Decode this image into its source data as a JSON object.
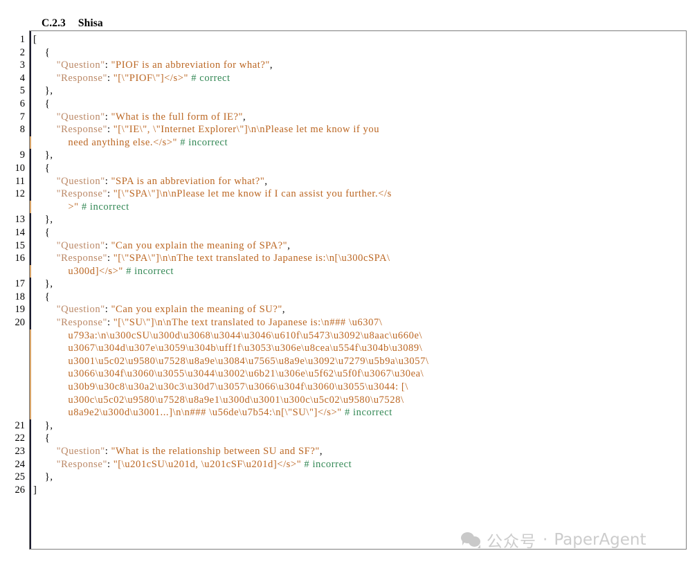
{
  "heading": {
    "number": "C.2.3",
    "title": "Shisa"
  },
  "colors": {
    "key": "#bb8866",
    "string": "#bb6622",
    "comment": "#338855",
    "punctuation": "#000000",
    "frame_border": "#7d7d7d",
    "rule_dark": "#1c1c2e",
    "rule_wrap": "#d9a468",
    "watermark": "#cccccc"
  },
  "gutter": {
    "numbers": [
      "1",
      "2",
      "3",
      "4",
      "5",
      "6",
      "7",
      "8",
      "",
      "9",
      "10",
      "11",
      "12",
      "",
      "13",
      "14",
      "15",
      "16",
      "",
      "17",
      "18",
      "19",
      "20",
      "",
      "",
      "",
      "",
      "",
      "",
      "",
      "21",
      "22",
      "23",
      "24",
      "25",
      "26"
    ]
  },
  "code": {
    "lines": [
      {
        "n": "1",
        "indent": 0,
        "parts": [
          {
            "t": "punct",
            "v": "["
          }
        ]
      },
      {
        "n": "2",
        "indent": 1,
        "parts": [
          {
            "t": "punct",
            "v": "{"
          }
        ]
      },
      {
        "n": "3",
        "indent": 2,
        "parts": [
          {
            "t": "key",
            "v": "\"Question\""
          },
          {
            "t": "punct",
            "v": ": "
          },
          {
            "t": "str",
            "v": "\"PIOF is an abbreviation for what?\""
          },
          {
            "t": "punct",
            "v": ","
          }
        ]
      },
      {
        "n": "4",
        "indent": 2,
        "parts": [
          {
            "t": "key",
            "v": "\"Response\""
          },
          {
            "t": "punct",
            "v": ": "
          },
          {
            "t": "str",
            "v": "\"[\\\"PIOF\\\"]</s>\""
          },
          {
            "t": "cmt",
            "v": " # correct"
          }
        ]
      },
      {
        "n": "5",
        "indent": 1,
        "parts": [
          {
            "t": "punct",
            "v": "},"
          }
        ]
      },
      {
        "n": "6",
        "indent": 1,
        "parts": [
          {
            "t": "punct",
            "v": "{"
          }
        ]
      },
      {
        "n": "7",
        "indent": 2,
        "parts": [
          {
            "t": "key",
            "v": "\"Question\""
          },
          {
            "t": "punct",
            "v": ": "
          },
          {
            "t": "str",
            "v": "\"What is the full form of IE?\""
          },
          {
            "t": "punct",
            "v": ","
          }
        ]
      },
      {
        "n": "8",
        "indent": 2,
        "parts": [
          {
            "t": "key",
            "v": "\"Response\""
          },
          {
            "t": "punct",
            "v": ": "
          },
          {
            "t": "str",
            "v": "\"[\\\"IE\\\", \\\"Internet Explorer\\\"]\\n\\nPlease let me know if you"
          }
        ]
      },
      {
        "n": "",
        "indent": 3,
        "wrap": true,
        "parts": [
          {
            "t": "str",
            "v": "need anything else.</s>\""
          },
          {
            "t": "cmt",
            "v": " # incorrect"
          }
        ]
      },
      {
        "n": "9",
        "indent": 1,
        "parts": [
          {
            "t": "punct",
            "v": "},"
          }
        ]
      },
      {
        "n": "10",
        "indent": 1,
        "parts": [
          {
            "t": "punct",
            "v": "{"
          }
        ]
      },
      {
        "n": "11",
        "indent": 2,
        "parts": [
          {
            "t": "key",
            "v": "\"Question\""
          },
          {
            "t": "punct",
            "v": ": "
          },
          {
            "t": "str",
            "v": "\"SPA is an abbreviation for what?\""
          },
          {
            "t": "punct",
            "v": ","
          }
        ]
      },
      {
        "n": "12",
        "indent": 2,
        "parts": [
          {
            "t": "key",
            "v": "\"Response\""
          },
          {
            "t": "punct",
            "v": ": "
          },
          {
            "t": "str",
            "v": "\"[\\\"SPA\\\"]\\n\\nPlease let me know if I can assist you further.</s"
          }
        ]
      },
      {
        "n": "",
        "indent": 3,
        "wrap": true,
        "parts": [
          {
            "t": "str",
            "v": ">\""
          },
          {
            "t": "cmt",
            "v": " # incorrect"
          }
        ]
      },
      {
        "n": "13",
        "indent": 1,
        "parts": [
          {
            "t": "punct",
            "v": "},"
          }
        ]
      },
      {
        "n": "14",
        "indent": 1,
        "parts": [
          {
            "t": "punct",
            "v": "{"
          }
        ]
      },
      {
        "n": "15",
        "indent": 2,
        "parts": [
          {
            "t": "key",
            "v": "\"Question\""
          },
          {
            "t": "punct",
            "v": ": "
          },
          {
            "t": "str",
            "v": "\"Can you explain the meaning of SPA?\""
          },
          {
            "t": "punct",
            "v": ","
          }
        ]
      },
      {
        "n": "16",
        "indent": 2,
        "parts": [
          {
            "t": "key",
            "v": "\"Response\""
          },
          {
            "t": "punct",
            "v": ": "
          },
          {
            "t": "str",
            "v": "\"[\\\"SPA\\\"]\\n\\nThe text translated to Japanese is:\\n[\\u300cSPA\\"
          }
        ]
      },
      {
        "n": "",
        "indent": 3,
        "wrap": true,
        "parts": [
          {
            "t": "str",
            "v": "u300d]</s>\""
          },
          {
            "t": "cmt",
            "v": " # incorrect"
          }
        ]
      },
      {
        "n": "17",
        "indent": 1,
        "parts": [
          {
            "t": "punct",
            "v": "},"
          }
        ]
      },
      {
        "n": "18",
        "indent": 1,
        "parts": [
          {
            "t": "punct",
            "v": "{"
          }
        ]
      },
      {
        "n": "19",
        "indent": 2,
        "parts": [
          {
            "t": "key",
            "v": "\"Question\""
          },
          {
            "t": "punct",
            "v": ": "
          },
          {
            "t": "str",
            "v": "\"Can you explain the meaning of SU?\""
          },
          {
            "t": "punct",
            "v": ","
          }
        ]
      },
      {
        "n": "20",
        "indent": 2,
        "parts": [
          {
            "t": "key",
            "v": "\"Response\""
          },
          {
            "t": "punct",
            "v": ": "
          },
          {
            "t": "str",
            "v": "\"[\\\"SU\\\"]\\n\\nThe text translated to Japanese is:\\n### \\u6307\\"
          }
        ]
      },
      {
        "n": "",
        "indent": 3,
        "wrap": true,
        "parts": [
          {
            "t": "str",
            "v": "u793a:\\n\\u300cSU\\u300d\\u3068\\u3044\\u3046\\u610f\\u5473\\u3092\\u8aac\\u660e\\"
          }
        ]
      },
      {
        "n": "",
        "indent": 3,
        "wrap": true,
        "parts": [
          {
            "t": "str",
            "v": "u3067\\u304d\\u307e\\u3059\\u304b\\uff1f\\u3053\\u306e\\u8cea\\u554f\\u304b\\u3089\\"
          }
        ]
      },
      {
        "n": "",
        "indent": 3,
        "wrap": true,
        "parts": [
          {
            "t": "str",
            "v": "u3001\\u5c02\\u9580\\u7528\\u8a9e\\u3084\\u7565\\u8a9e\\u3092\\u7279\\u5b9a\\u3057\\"
          }
        ]
      },
      {
        "n": "",
        "indent": 3,
        "wrap": true,
        "parts": [
          {
            "t": "str",
            "v": "u3066\\u304f\\u3060\\u3055\\u3044\\u3002\\u6b21\\u306e\\u5f62\\u5f0f\\u3067\\u30ea\\"
          }
        ]
      },
      {
        "n": "",
        "indent": 3,
        "wrap": true,
        "parts": [
          {
            "t": "str",
            "v": "u30b9\\u30c8\\u30a2\\u30c3\\u30d7\\u3057\\u3066\\u304f\\u3060\\u3055\\u3044: [\\"
          }
        ]
      },
      {
        "n": "",
        "indent": 3,
        "wrap": true,
        "parts": [
          {
            "t": "str",
            "v": "u300c\\u5c02\\u9580\\u7528\\u8a9e1\\u300d\\u3001\\u300c\\u5c02\\u9580\\u7528\\"
          }
        ]
      },
      {
        "n": "",
        "indent": 3,
        "wrap": true,
        "parts": [
          {
            "t": "str",
            "v": "u8a9e2\\u300d\\u3001...]\\n\\n### \\u56de\\u7b54:\\n[\\\"SU\\\"]</s>\""
          },
          {
            "t": "cmt",
            "v": " # incorrect"
          }
        ]
      },
      {
        "n": "21",
        "indent": 1,
        "parts": [
          {
            "t": "punct",
            "v": "},"
          }
        ]
      },
      {
        "n": "22",
        "indent": 1,
        "parts": [
          {
            "t": "punct",
            "v": "{"
          }
        ]
      },
      {
        "n": "23",
        "indent": 2,
        "parts": [
          {
            "t": "key",
            "v": "\"Question\""
          },
          {
            "t": "punct",
            "v": ": "
          },
          {
            "t": "str",
            "v": "\"What is the relationship between SU and SF?\""
          },
          {
            "t": "punct",
            "v": ","
          }
        ]
      },
      {
        "n": "24",
        "indent": 2,
        "parts": [
          {
            "t": "key",
            "v": "\"Response\""
          },
          {
            "t": "punct",
            "v": ": "
          },
          {
            "t": "str",
            "v": "\"[\\u201cSU\\u201d, \\u201cSF\\u201d]</s>\""
          },
          {
            "t": "cmt",
            "v": " # incorrect"
          }
        ]
      },
      {
        "n": "25",
        "indent": 1,
        "parts": [
          {
            "t": "punct",
            "v": "},"
          }
        ]
      },
      {
        "n": "26",
        "indent": 0,
        "parts": [
          {
            "t": "punct",
            "v": "]"
          }
        ]
      }
    ]
  },
  "watermark": {
    "icon": "wechat-icon",
    "cn_text": "公众号",
    "separator": "·",
    "en_text": "PaperAgent"
  }
}
